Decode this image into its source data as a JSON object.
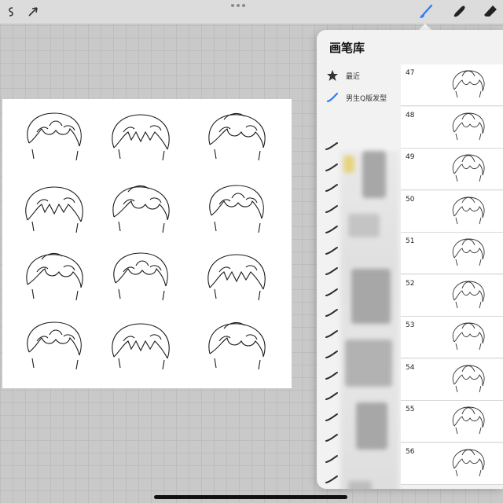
{
  "panel": {
    "title": "画笔库",
    "sets": [
      {
        "label": "最近",
        "icon": "star-icon"
      },
      {
        "label": "男生Q版发型",
        "icon": "brush-stroke-icon",
        "selected": true
      }
    ],
    "brushes": [
      {
        "num": "47"
      },
      {
        "num": "48"
      },
      {
        "num": "49"
      },
      {
        "num": "50"
      },
      {
        "num": "51"
      },
      {
        "num": "52"
      },
      {
        "num": "53"
      },
      {
        "num": "54"
      },
      {
        "num": "55"
      },
      {
        "num": "56"
      }
    ]
  },
  "colors": {
    "accent": "#2d7ef7",
    "toolbar": "#dcdcdc",
    "panel": "#f2f2f2"
  }
}
